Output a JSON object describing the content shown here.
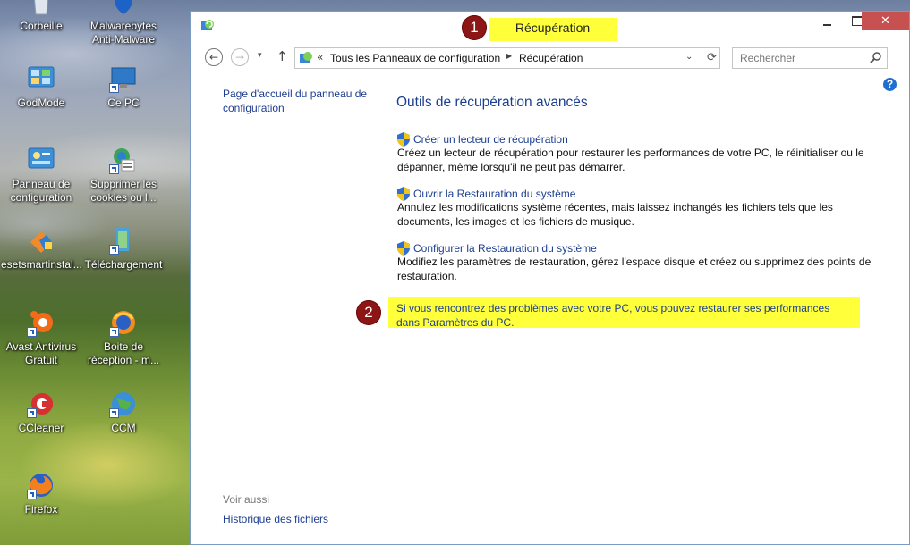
{
  "desktop": {
    "icons": [
      {
        "label": "Corbeille",
        "icon": "recycle-bin-icon"
      },
      {
        "label": "Malwarebytes\nAnti-Malware",
        "icon": "malwarebytes-icon"
      },
      {
        "label": "GodMode",
        "icon": "godmode-icon"
      },
      {
        "label": "Ce PC",
        "icon": "this-pc-icon"
      },
      {
        "label": "Panneau de\nconfiguration",
        "icon": "control-panel-icon"
      },
      {
        "label": "Supprimer les\ncookies ou l...",
        "icon": "delete-cookies-icon"
      },
      {
        "label": "esetsmartinstal...",
        "icon": "eset-installer-icon"
      },
      {
        "label": "Téléchargement",
        "icon": "download-icon"
      },
      {
        "label": "Avast Antivirus\nGratuit",
        "icon": "avast-icon"
      },
      {
        "label": "Boite de\nréception - m...",
        "icon": "thunderbird-inbox-icon"
      },
      {
        "label": "CCleaner",
        "icon": "ccleaner-icon"
      },
      {
        "label": "CCM",
        "icon": "ccm-icon"
      },
      {
        "label": "Firefox",
        "icon": "firefox-icon"
      }
    ]
  },
  "window": {
    "title": "Récupération",
    "close_symbol": "✕",
    "annotation_1": "1",
    "annotation_2": "2"
  },
  "navbar": {
    "back_symbol": "←",
    "forward_symbol": "→",
    "up_symbol": "↑",
    "address_prefix": "«",
    "breadcrumbs": [
      "Tous les Panneaux de configuration",
      "Récupération"
    ],
    "search_placeholder": "Rechercher"
  },
  "sidebar": {
    "home_link": "Page d'accueil du panneau de configuration",
    "see_also_label": "Voir aussi",
    "see_also_links": [
      "Historique des fichiers"
    ]
  },
  "main": {
    "heading": "Outils de récupération avancés",
    "tasks": [
      {
        "link": "Créer un lecteur de récupération",
        "description": "Créez un lecteur de récupération pour restaurer les performances de votre PC, le réinitialiser ou le dépanner, même lorsqu'il ne peut pas démarrer."
      },
      {
        "link": "Ouvrir la Restauration du système",
        "description": "Annulez les modifications système récentes, mais laissez inchangés les fichiers tels que les documents, les images et les fichiers de musique."
      },
      {
        "link": "Configurer la Restauration du système",
        "description": "Modifiez les paramètres de restauration, gérez l'espace disque et créez ou supprimez des points de restauration."
      }
    ],
    "reset_link": "Si vous rencontrez des problèmes avec votre PC, vous pouvez restaurer ses performances dans Paramètres du PC."
  },
  "colors": {
    "link": "#1d3f8f",
    "highlight": "#ffff3a",
    "badge": "#8c1515",
    "close_button": "#c75050"
  }
}
